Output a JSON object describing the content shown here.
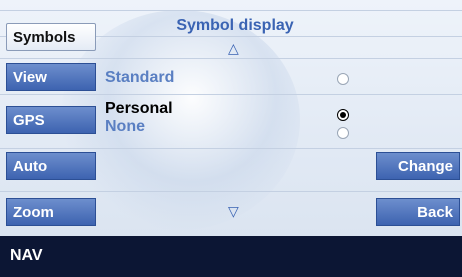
{
  "sidebar": {
    "items": [
      {
        "label": "Symbols",
        "active": true
      },
      {
        "label": "View",
        "active": false
      },
      {
        "label": "GPS",
        "active": false
      },
      {
        "label": "Auto",
        "active": false
      },
      {
        "label": "Zoom",
        "active": false
      }
    ]
  },
  "header": {
    "title": "Symbol display",
    "scroll_up_icon": "triangle-up-icon",
    "scroll_down_icon": "triangle-down-icon"
  },
  "options": [
    {
      "label": "Standard",
      "selected": false
    },
    {
      "label": "Personal",
      "selected": true
    },
    {
      "label": "None",
      "selected": false
    }
  ],
  "actions": {
    "change_label": "Change",
    "back_label": "Back"
  },
  "status_bar": {
    "label": "NAV"
  },
  "colors": {
    "button_blue": "#4a6fb8",
    "title_blue": "#3a63b3",
    "status_bar": "#0c1634",
    "background": "#e4ebf5"
  }
}
